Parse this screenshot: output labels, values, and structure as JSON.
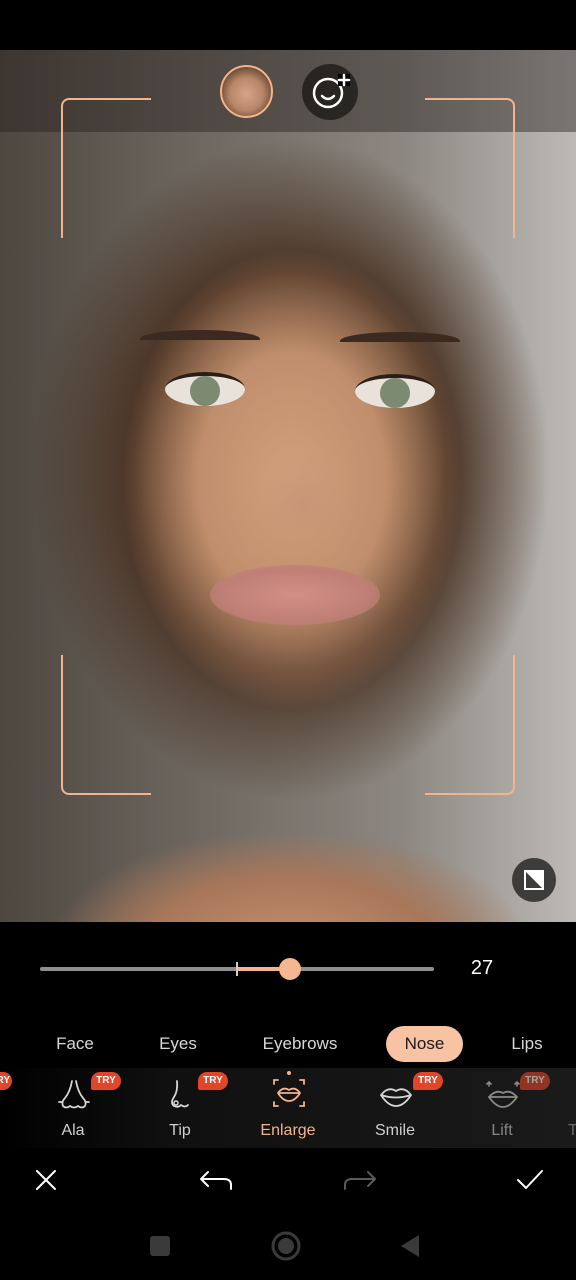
{
  "editor": {
    "slider": {
      "value": 27,
      "value_label": "27",
      "min": -100,
      "max": 100
    },
    "tabs": [
      {
        "label": "Face",
        "active": false
      },
      {
        "label": "Eyes",
        "active": false
      },
      {
        "label": "Eyebrows",
        "active": false
      },
      {
        "label": "Nose",
        "active": true
      },
      {
        "label": "Lips",
        "active": false
      }
    ],
    "tools": [
      {
        "label": "Ala",
        "badge": "TRY",
        "icon": "nose-ala-icon"
      },
      {
        "label": "Tip",
        "badge": "TRY",
        "icon": "nose-tip-icon"
      },
      {
        "label": "Enlarge",
        "badge": "",
        "icon": "lips-enlarge-icon",
        "active": true
      },
      {
        "label": "Smile",
        "badge": "TRY",
        "icon": "lips-smile-icon"
      },
      {
        "label": "Lift",
        "badge": "TRY",
        "icon": "lips-lift-icon"
      }
    ],
    "edge_badge": "TRY",
    "edge_label": "T"
  },
  "colors": {
    "accent": "#f3b38e",
    "tab_active_bg": "#f7c3a3",
    "badge": "#e0462a",
    "background": "#000000"
  },
  "icons": {
    "add_face": "add-face-icon",
    "compare": "compare-icon",
    "close": "close-icon",
    "undo": "undo-icon",
    "redo": "redo-icon",
    "confirm": "check-icon",
    "recents": "square-nav-icon",
    "home": "circle-nav-icon",
    "back": "triangle-nav-icon"
  }
}
